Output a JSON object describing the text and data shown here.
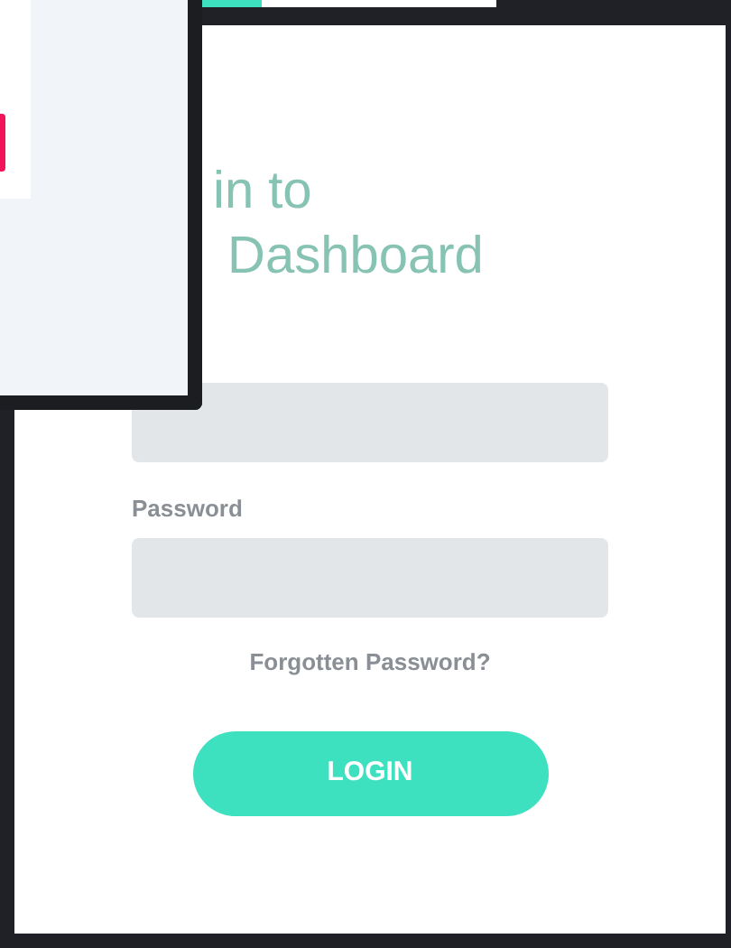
{
  "title_lines": [
    "in to",
    "Dashboard"
  ],
  "password_label": "Password",
  "forgot_link": "Forgotten Password?",
  "login_button": "LOGIN"
}
